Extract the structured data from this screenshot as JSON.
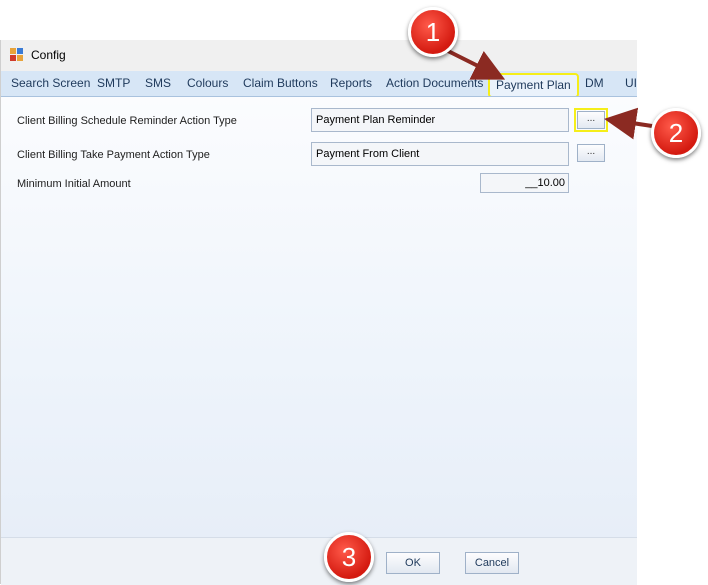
{
  "window": {
    "title": "Config"
  },
  "tabs": [
    {
      "label": "Search Screen"
    },
    {
      "label": "SMTP"
    },
    {
      "label": "SMS"
    },
    {
      "label": "Colours"
    },
    {
      "label": "Claim Buttons"
    },
    {
      "label": "Reports"
    },
    {
      "label": "Action Documents"
    },
    {
      "label": "Payment Plan",
      "active": true
    },
    {
      "label": "DM"
    },
    {
      "label": "UI"
    }
  ],
  "form": {
    "reminder_label": "Client Billing Schedule Reminder Action Type",
    "reminder_value": "Payment Plan Reminder",
    "take_payment_label": "Client Billing Take Payment Action Type",
    "take_payment_value": "Payment From Client",
    "min_amount_label": "Minimum Initial Amount",
    "min_amount_value": "__10.00",
    "browse_label": "..."
  },
  "footer": {
    "ok_label": "OK",
    "cancel_label": "Cancel"
  },
  "callouts": {
    "one": "1",
    "two": "2",
    "three": "3"
  },
  "colors": {
    "callout": "#d41a10",
    "highlight": "#f5ee1a",
    "arrow": "#8b2a22",
    "tabstrip": "#d7e6f6"
  }
}
